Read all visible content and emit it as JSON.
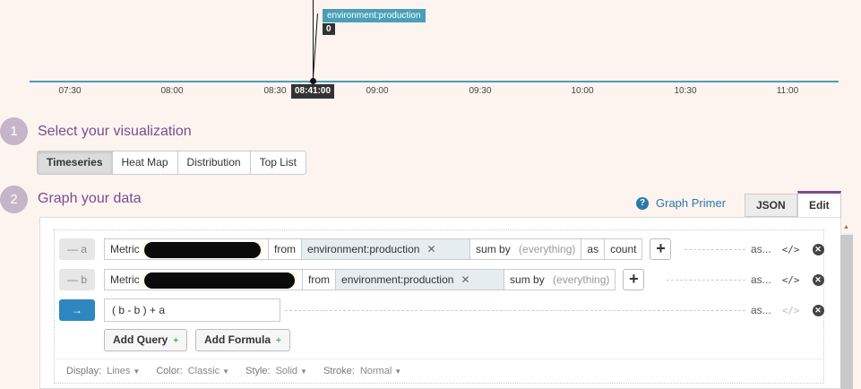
{
  "timeline": {
    "tag_label": "environment:production",
    "tag_value": "0",
    "cursor_time": "08:41:00",
    "ticks": [
      "07:30",
      "08:00",
      "08:30",
      "09:00",
      "09:30",
      "10:00",
      "10:30",
      "11:00"
    ]
  },
  "step1": {
    "number": "1",
    "title": "Select your visualization"
  },
  "viz_types": [
    "Timeseries",
    "Heat Map",
    "Distribution",
    "Top List"
  ],
  "viz_selected": "Timeseries",
  "step2": {
    "number": "2",
    "title": "Graph your data"
  },
  "graph_primer": "Graph Primer",
  "tabs": {
    "json": "JSON",
    "edit": "Edit"
  },
  "queries": [
    {
      "label": "— a",
      "metric_label": "Metric",
      "from_label": "from",
      "tag": "environment:production",
      "sum_by_label": "sum by",
      "sum_by_value": "(everything)",
      "as_label": "as",
      "as_value": "count",
      "alias": "as..."
    },
    {
      "label": "— b",
      "metric_label": "Metric",
      "from_label": "from",
      "tag": "environment:production",
      "sum_by_label": "sum by",
      "sum_by_value": "(everything)",
      "alias": "as..."
    }
  ],
  "formula": {
    "label": "→",
    "expression": "( b - b ) + a",
    "alias": "as..."
  },
  "buttons": {
    "add_query": "Add Query",
    "add_formula": "Add Formula",
    "plus": "+"
  },
  "display_options": [
    {
      "label": "Display:",
      "value": "Lines"
    },
    {
      "label": "Color:",
      "value": "Classic"
    },
    {
      "label": "Style:",
      "value": "Solid"
    },
    {
      "label": "Stroke:",
      "value": "Normal"
    }
  ],
  "icons": {
    "code": "code-icon",
    "remove": "close-circle-icon",
    "help": "help-circle-icon"
  },
  "colors": {
    "accent": "#7a4c92",
    "link": "#2a7aa8",
    "series": "#4a9fb8"
  }
}
